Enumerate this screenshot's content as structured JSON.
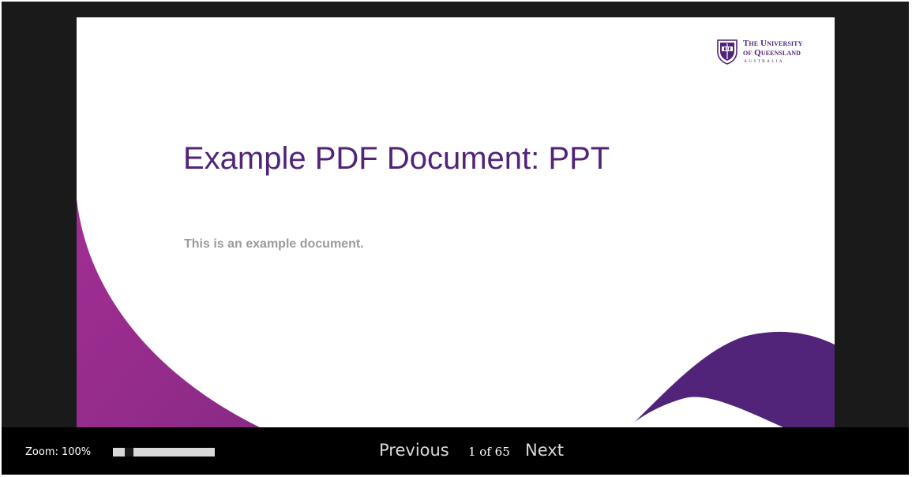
{
  "slide": {
    "logo": {
      "line1": "The University",
      "line2": "of Queensland",
      "line3": "AUSTRALIA"
    },
    "title": "Example PDF Document: PPT",
    "subtitle": "This is an example document.",
    "colors": {
      "title": "#51247a",
      "subtitle": "#9b9b9b",
      "left_swoosh_light": "#a22e93",
      "left_swoosh_dark": "#8a2a86",
      "right_swoosh": "#51247a"
    }
  },
  "toolbar": {
    "zoom_label": "Zoom: 100%",
    "zoom_percent": 100,
    "previous_label": "Previous",
    "page_indicator": "1 of 65",
    "next_label": "Next"
  }
}
